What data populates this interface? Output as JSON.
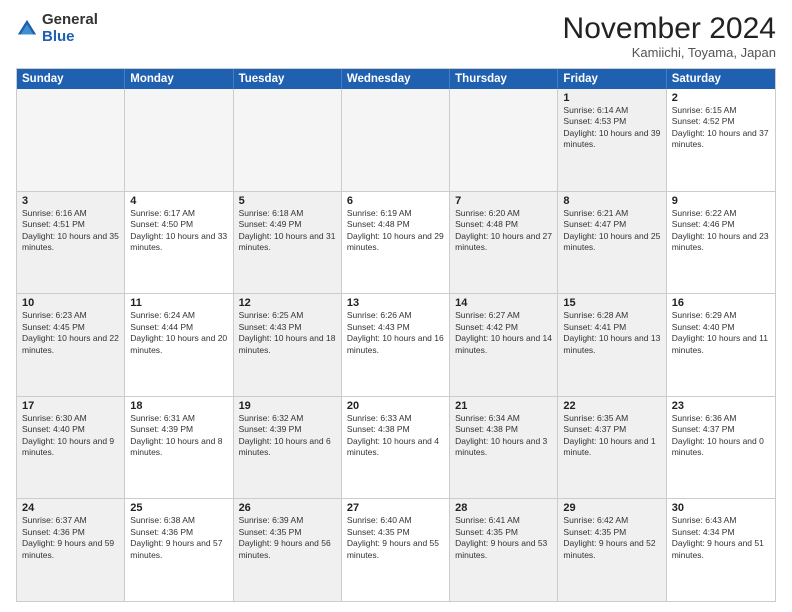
{
  "logo": {
    "general": "General",
    "blue": "Blue"
  },
  "title": "November 2024",
  "subtitle": "Kamiichi, Toyama, Japan",
  "days": [
    "Sunday",
    "Monday",
    "Tuesday",
    "Wednesday",
    "Thursday",
    "Friday",
    "Saturday"
  ],
  "rows": [
    [
      {
        "day": "",
        "info": "",
        "empty": true
      },
      {
        "day": "",
        "info": "",
        "empty": true
      },
      {
        "day": "",
        "info": "",
        "empty": true
      },
      {
        "day": "",
        "info": "",
        "empty": true
      },
      {
        "day": "",
        "info": "",
        "empty": true
      },
      {
        "day": "1",
        "info": "Sunrise: 6:14 AM\nSunset: 4:53 PM\nDaylight: 10 hours and 39 minutes.",
        "shaded": true
      },
      {
        "day": "2",
        "info": "Sunrise: 6:15 AM\nSunset: 4:52 PM\nDaylight: 10 hours and 37 minutes.",
        "shaded": false
      }
    ],
    [
      {
        "day": "3",
        "info": "Sunrise: 6:16 AM\nSunset: 4:51 PM\nDaylight: 10 hours and 35 minutes.",
        "shaded": true
      },
      {
        "day": "4",
        "info": "Sunrise: 6:17 AM\nSunset: 4:50 PM\nDaylight: 10 hours and 33 minutes."
      },
      {
        "day": "5",
        "info": "Sunrise: 6:18 AM\nSunset: 4:49 PM\nDaylight: 10 hours and 31 minutes.",
        "shaded": true
      },
      {
        "day": "6",
        "info": "Sunrise: 6:19 AM\nSunset: 4:48 PM\nDaylight: 10 hours and 29 minutes."
      },
      {
        "day": "7",
        "info": "Sunrise: 6:20 AM\nSunset: 4:48 PM\nDaylight: 10 hours and 27 minutes.",
        "shaded": true
      },
      {
        "day": "8",
        "info": "Sunrise: 6:21 AM\nSunset: 4:47 PM\nDaylight: 10 hours and 25 minutes.",
        "shaded": true
      },
      {
        "day": "9",
        "info": "Sunrise: 6:22 AM\nSunset: 4:46 PM\nDaylight: 10 hours and 23 minutes."
      }
    ],
    [
      {
        "day": "10",
        "info": "Sunrise: 6:23 AM\nSunset: 4:45 PM\nDaylight: 10 hours and 22 minutes.",
        "shaded": true
      },
      {
        "day": "11",
        "info": "Sunrise: 6:24 AM\nSunset: 4:44 PM\nDaylight: 10 hours and 20 minutes."
      },
      {
        "day": "12",
        "info": "Sunrise: 6:25 AM\nSunset: 4:43 PM\nDaylight: 10 hours and 18 minutes.",
        "shaded": true
      },
      {
        "day": "13",
        "info": "Sunrise: 6:26 AM\nSunset: 4:43 PM\nDaylight: 10 hours and 16 minutes."
      },
      {
        "day": "14",
        "info": "Sunrise: 6:27 AM\nSunset: 4:42 PM\nDaylight: 10 hours and 14 minutes.",
        "shaded": true
      },
      {
        "day": "15",
        "info": "Sunrise: 6:28 AM\nSunset: 4:41 PM\nDaylight: 10 hours and 13 minutes.",
        "shaded": true
      },
      {
        "day": "16",
        "info": "Sunrise: 6:29 AM\nSunset: 4:40 PM\nDaylight: 10 hours and 11 minutes."
      }
    ],
    [
      {
        "day": "17",
        "info": "Sunrise: 6:30 AM\nSunset: 4:40 PM\nDaylight: 10 hours and 9 minutes.",
        "shaded": true
      },
      {
        "day": "18",
        "info": "Sunrise: 6:31 AM\nSunset: 4:39 PM\nDaylight: 10 hours and 8 minutes."
      },
      {
        "day": "19",
        "info": "Sunrise: 6:32 AM\nSunset: 4:39 PM\nDaylight: 10 hours and 6 minutes.",
        "shaded": true
      },
      {
        "day": "20",
        "info": "Sunrise: 6:33 AM\nSunset: 4:38 PM\nDaylight: 10 hours and 4 minutes."
      },
      {
        "day": "21",
        "info": "Sunrise: 6:34 AM\nSunset: 4:38 PM\nDaylight: 10 hours and 3 minutes.",
        "shaded": true
      },
      {
        "day": "22",
        "info": "Sunrise: 6:35 AM\nSunset: 4:37 PM\nDaylight: 10 hours and 1 minute.",
        "shaded": true
      },
      {
        "day": "23",
        "info": "Sunrise: 6:36 AM\nSunset: 4:37 PM\nDaylight: 10 hours and 0 minutes."
      }
    ],
    [
      {
        "day": "24",
        "info": "Sunrise: 6:37 AM\nSunset: 4:36 PM\nDaylight: 9 hours and 59 minutes.",
        "shaded": true
      },
      {
        "day": "25",
        "info": "Sunrise: 6:38 AM\nSunset: 4:36 PM\nDaylight: 9 hours and 57 minutes."
      },
      {
        "day": "26",
        "info": "Sunrise: 6:39 AM\nSunset: 4:35 PM\nDaylight: 9 hours and 56 minutes.",
        "shaded": true
      },
      {
        "day": "27",
        "info": "Sunrise: 6:40 AM\nSunset: 4:35 PM\nDaylight: 9 hours and 55 minutes."
      },
      {
        "day": "28",
        "info": "Sunrise: 6:41 AM\nSunset: 4:35 PM\nDaylight: 9 hours and 53 minutes.",
        "shaded": true
      },
      {
        "day": "29",
        "info": "Sunrise: 6:42 AM\nSunset: 4:35 PM\nDaylight: 9 hours and 52 minutes.",
        "shaded": true
      },
      {
        "day": "30",
        "info": "Sunrise: 6:43 AM\nSunset: 4:34 PM\nDaylight: 9 hours and 51 minutes."
      }
    ]
  ]
}
